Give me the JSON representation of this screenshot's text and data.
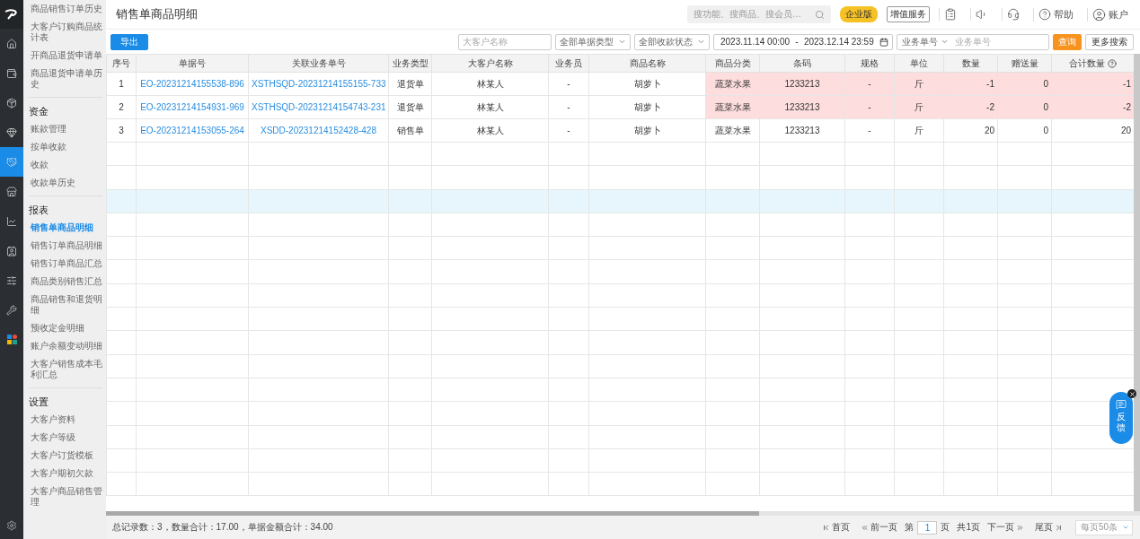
{
  "rail": {
    "items": [
      {
        "kind": "home",
        "selected": false
      },
      {
        "kind": "wallet",
        "selected": false
      },
      {
        "kind": "box",
        "selected": false
      },
      {
        "kind": "gem",
        "selected": false
      },
      {
        "kind": "handshake",
        "selected": true
      },
      {
        "kind": "store",
        "selected": false
      },
      {
        "kind": "chart",
        "selected": false
      },
      {
        "kind": "contact",
        "selected": false
      },
      {
        "kind": "sliders",
        "selected": false
      },
      {
        "kind": "tools",
        "selected": false
      },
      {
        "kind": "apps",
        "selected": false
      }
    ]
  },
  "sidebar": {
    "groups": [
      {
        "items": [
          {
            "label": "商品销售订单历史",
            "selected": false
          },
          {
            "label": "大客户订购商品统计表",
            "selected": false
          },
          {
            "label": "开商品退货申请单",
            "selected": false
          },
          {
            "label": "商品退货申请单历史",
            "selected": false
          }
        ]
      },
      {
        "heading": "资金",
        "items": [
          {
            "label": "账款管理",
            "selected": false
          },
          {
            "label": "按单收款",
            "selected": false
          },
          {
            "label": "收款",
            "selected": false
          },
          {
            "label": "收款单历史",
            "selected": false
          }
        ]
      },
      {
        "heading": "报表",
        "items": [
          {
            "label": "销售单商品明细",
            "selected": true
          },
          {
            "label": "销售订单商品明细",
            "selected": false
          },
          {
            "label": "销售订单商品汇总",
            "selected": false
          },
          {
            "label": "商品类别销售汇总",
            "selected": false
          },
          {
            "label": "商品销售和退货明细",
            "selected": false
          },
          {
            "label": "预收定金明细",
            "selected": false
          },
          {
            "label": "账户余额变动明细",
            "selected": false
          },
          {
            "label": "大客户销售成本毛利汇总",
            "selected": false
          }
        ]
      },
      {
        "heading": "设置",
        "items": [
          {
            "label": "大客户资料",
            "selected": false
          },
          {
            "label": "大客户等级",
            "selected": false
          },
          {
            "label": "大客户订货模板",
            "selected": false
          },
          {
            "label": "大客户期初欠款",
            "selected": false
          },
          {
            "label": "大客户商品销售管理",
            "selected": false
          }
        ]
      }
    ]
  },
  "header": {
    "title": "销售单商品明细",
    "search": {
      "placeholder": "搜功能、搜商品、搜会员…"
    },
    "edition_badge": "企业版",
    "service_button": "增值服务",
    "help": "帮助",
    "account": "账户"
  },
  "toolbar": {
    "export_button": "导出",
    "customer_field": {
      "placeholder": "大客户名称"
    },
    "type_select": "全部单据类型",
    "status_select": "全部收款状态",
    "date_range": {
      "start": "2023.11.14 00:00",
      "separator": "-",
      "end": "2023.12.14 23:59"
    },
    "number_type_select": "业务单号",
    "number_field": {
      "placeholder": "业务单号"
    },
    "query_button": "查询",
    "more_button": "更多搜索"
  },
  "table": {
    "columns": [
      {
        "label": "序号",
        "kind": "text",
        "help_icon": false
      },
      {
        "label": "单据号",
        "kind": "link",
        "help_icon": false
      },
      {
        "label": "关联业务单号",
        "kind": "link",
        "help_icon": false
      },
      {
        "label": "业务类型",
        "kind": "text",
        "help_icon": false
      },
      {
        "label": "大客户名称",
        "kind": "text",
        "help_icon": false
      },
      {
        "label": "业务员",
        "kind": "text",
        "help_icon": false
      },
      {
        "label": "商品名称",
        "kind": "text",
        "help_icon": false
      },
      {
        "label": "商品分类",
        "kind": "text",
        "help_icon": false
      },
      {
        "label": "条码",
        "kind": "text",
        "help_icon": false
      },
      {
        "label": "规格",
        "kind": "text",
        "help_icon": false
      },
      {
        "label": "单位",
        "kind": "text",
        "help_icon": false
      },
      {
        "label": "数量",
        "kind": "number",
        "help_icon": false
      },
      {
        "label": "赠送量",
        "kind": "number",
        "help_icon": false
      },
      {
        "label": "合计数量",
        "kind": "number",
        "help_icon": true
      }
    ],
    "rows": [
      {
        "flagged": true,
        "cells": [
          "1",
          "EO-20231214155538-896",
          "XSTHSQD-20231214155155-733",
          "退货单",
          "林某人",
          "-",
          "胡萝卜",
          "蔬菜水果",
          "1233213",
          "-",
          "斤",
          "-1",
          "0",
          "-1"
        ]
      },
      {
        "flagged": true,
        "cells": [
          "2",
          "EO-20231214154931-969",
          "XSTHSQD-20231214154743-231",
          "退货单",
          "林某人",
          "-",
          "胡萝卜",
          "蔬菜水果",
          "1233213",
          "-",
          "斤",
          "-2",
          "0",
          "-2"
        ]
      },
      {
        "flagged": false,
        "cells": [
          "3",
          "EO-20231214153055-264",
          "XSDD-20231214152428-428",
          "销售单",
          "林某人",
          "-",
          "胡萝卜",
          "蔬菜水果",
          "1233213",
          "-",
          "斤",
          "20",
          "0",
          "20"
        ]
      }
    ],
    "blank_rows": [
      {
        "selected": false
      },
      {
        "selected": false
      },
      {
        "selected": true
      },
      {
        "selected": false
      },
      {
        "selected": false
      },
      {
        "selected": false
      },
      {
        "selected": false
      },
      {
        "selected": false
      },
      {
        "selected": false
      },
      {
        "selected": false
      },
      {
        "selected": false
      },
      {
        "selected": false
      },
      {
        "selected": false
      },
      {
        "selected": false
      },
      {
        "selected": false
      }
    ]
  },
  "footer": {
    "summary": "总记录数：3，数量合计：17.00，单据金额合计：34.00",
    "pager": {
      "first": "首页",
      "prev": "前一页",
      "page_prefix": "第",
      "page": "1",
      "page_suffix": "页",
      "total": "共1页",
      "next": "下一页",
      "last": "尾页",
      "page_size": "每页50条"
    }
  },
  "feedback": {
    "label": "反馈"
  }
}
